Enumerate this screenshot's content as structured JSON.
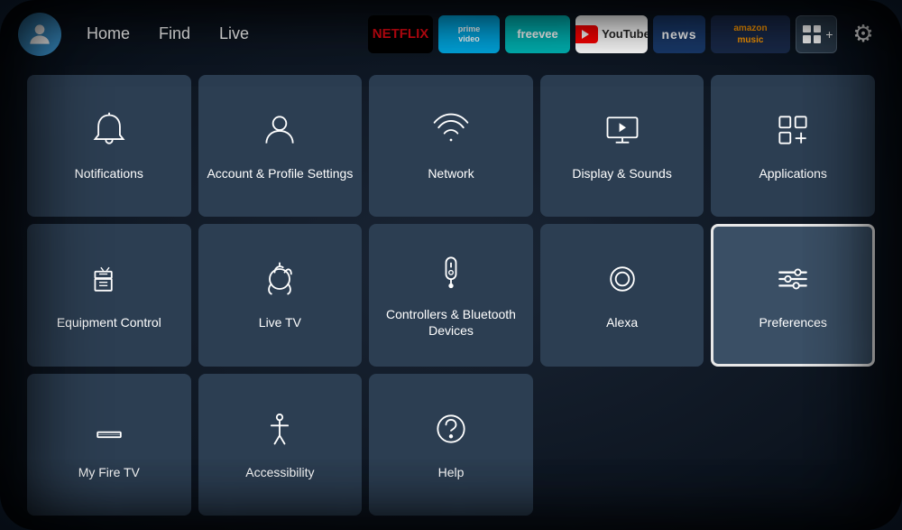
{
  "nav": {
    "links": [
      "Home",
      "Find",
      "Live"
    ]
  },
  "apps": [
    {
      "name": "Netflix",
      "id": "netflix"
    },
    {
      "name": "Prime Video",
      "id": "prime"
    },
    {
      "name": "Freevee",
      "id": "freevee"
    },
    {
      "name": "YouTube",
      "id": "youtube"
    },
    {
      "name": "news",
      "id": "news"
    },
    {
      "name": "amazon music",
      "id": "music"
    },
    {
      "name": "Grid",
      "id": "grid"
    },
    {
      "name": "Settings",
      "id": "settings"
    }
  ],
  "tiles": [
    {
      "id": "notifications",
      "label": "Notifications",
      "focused": false
    },
    {
      "id": "account",
      "label": "Account & Profile Settings",
      "focused": false
    },
    {
      "id": "network",
      "label": "Network",
      "focused": false
    },
    {
      "id": "display",
      "label": "Display & Sounds",
      "focused": false
    },
    {
      "id": "applications",
      "label": "Applications",
      "focused": false
    },
    {
      "id": "equipment",
      "label": "Equipment Control",
      "focused": false
    },
    {
      "id": "livetv",
      "label": "Live TV",
      "focused": false
    },
    {
      "id": "controllers",
      "label": "Controllers & Bluetooth Devices",
      "focused": false
    },
    {
      "id": "alexa",
      "label": "Alexa",
      "focused": false
    },
    {
      "id": "preferences",
      "label": "Preferences",
      "focused": true
    },
    {
      "id": "myfiretv",
      "label": "My Fire TV",
      "focused": false
    },
    {
      "id": "accessibility",
      "label": "Accessibility",
      "focused": false
    },
    {
      "id": "help",
      "label": "Help",
      "focused": false
    }
  ]
}
